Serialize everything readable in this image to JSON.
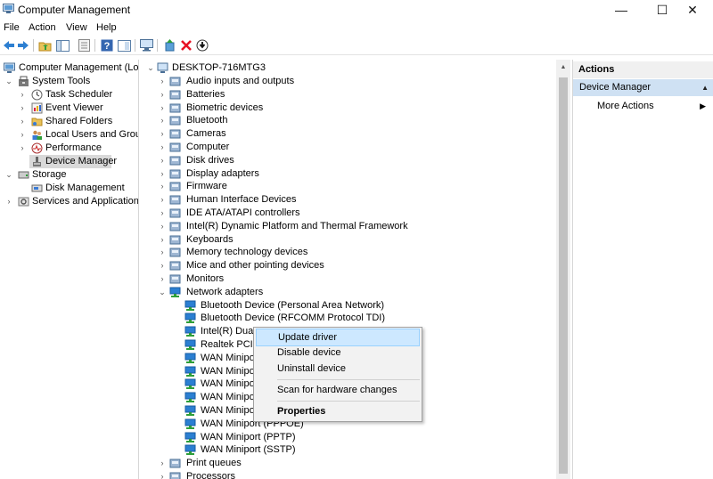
{
  "window": {
    "title": "Computer Management",
    "min_glyph": "—",
    "max_glyph": "☐",
    "close_glyph": "✕"
  },
  "menu": [
    "File",
    "Action",
    "View",
    "Help"
  ],
  "toolbar": [
    "back-icon",
    "forward-icon",
    "up-folder-icon",
    "show-hide-tree-icon",
    "export-list-icon",
    "help-icon",
    "properties-icon",
    "monitor-icon",
    "add-driver-icon",
    "uninstall-icon",
    "download-icon"
  ],
  "left_tree": {
    "root": "Computer Management (Local",
    "system_tools": "System Tools",
    "items": [
      "Task Scheduler",
      "Event Viewer",
      "Shared Folders",
      "Local Users and Groups",
      "Performance",
      "Device Manager"
    ],
    "storage": "Storage",
    "disk_management": "Disk Management",
    "services": "Services and Applications"
  },
  "device_tree": {
    "root": "DESKTOP-716MTG3",
    "categories_before": [
      "Audio inputs and outputs",
      "Batteries",
      "Biometric devices",
      "Bluetooth",
      "Cameras",
      "Computer",
      "Disk drives",
      "Display adapters",
      "Firmware",
      "Human Interface Devices",
      "IDE ATA/ATAPI controllers",
      "Intel(R) Dynamic Platform and Thermal Framework",
      "Keyboards",
      "Memory technology devices",
      "Mice and other pointing devices",
      "Monitors"
    ],
    "network": "Network adapters",
    "network_children": [
      "Bluetooth Device (Personal Area Network)",
      "Bluetooth Device (RFCOMM Protocol TDI)",
      "Intel(R) Dual I",
      "Realtek PCIe (",
      "WAN Minipor",
      "WAN Minipor",
      "WAN Minipor",
      "WAN Minipor",
      "WAN Minipor",
      "WAN Miniport (PPPOE)",
      "WAN Miniport (PPTP)",
      "WAN Miniport (SSTP)"
    ],
    "categories_after": [
      "Print queues",
      "Processors"
    ]
  },
  "context_menu": {
    "update": "Update driver",
    "disable": "Disable device",
    "uninstall": "Uninstall device",
    "scan": "Scan for hardware changes",
    "properties": "Properties"
  },
  "actions": {
    "header": "Actions",
    "section": "Device Manager",
    "more": "More Actions"
  },
  "colors": {
    "selection": "#d9d9d9",
    "menu_highlight": "#cde8ff",
    "actions_section": "#cfe1f3",
    "uninstall_red": "#e81123"
  }
}
